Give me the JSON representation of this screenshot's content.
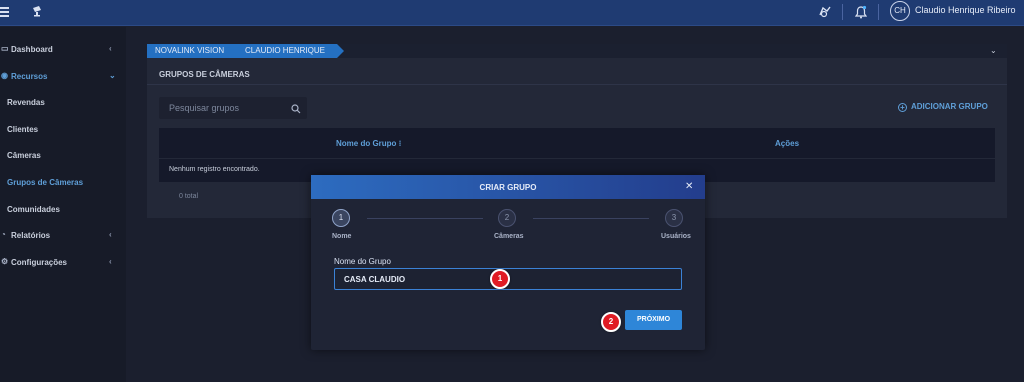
{
  "topbar": {
    "user_initials": "CH",
    "user_name": "Claudio Henrique Ribeiro"
  },
  "sidebar": {
    "items": [
      {
        "label": "Dashboard",
        "icon": "calendar-icon",
        "chevron": "‹"
      },
      {
        "label": "Recursos",
        "icon": "camera-icon",
        "chevron": "⌄"
      },
      {
        "label": "Revendas"
      },
      {
        "label": "Clientes"
      },
      {
        "label": "Câmeras"
      },
      {
        "label": "Grupos de Câmeras"
      },
      {
        "label": "Comunidades"
      },
      {
        "label": "Relatórios",
        "icon": "report-icon",
        "chevron": "‹"
      },
      {
        "label": "Configurações",
        "icon": "settings-icon",
        "chevron": "‹"
      }
    ],
    "active_color": "#5f9fd8"
  },
  "breadcrumb": {
    "items": [
      "NOVALINK VISION",
      "CLAUDIO HENRIQUE"
    ]
  },
  "page": {
    "title": "GRUPOS DE CÂMERAS",
    "search_placeholder": "Pesquisar grupos",
    "add_button": "ADICIONAR GRUPO",
    "table": {
      "columns": [
        "Nome do Grupo",
        "Ações"
      ],
      "empty_message": "Nenhum registro encontrado.",
      "total": "0 total"
    }
  },
  "modal": {
    "title": "CRIAR GRUPO",
    "steps": [
      {
        "number": "1",
        "label": "Nome"
      },
      {
        "number": "2",
        "label": "Câmeras"
      },
      {
        "number": "3",
        "label": "Usuários"
      }
    ],
    "field_label": "Nome do Grupo",
    "field_value": "CASA CLAUDIO",
    "next_button": "PRÓXIMO"
  },
  "annotations": [
    "1",
    "2"
  ],
  "colors": {
    "topbar": "#1f3b72",
    "accent": "#2e86d8",
    "badge": "#e01b24"
  }
}
